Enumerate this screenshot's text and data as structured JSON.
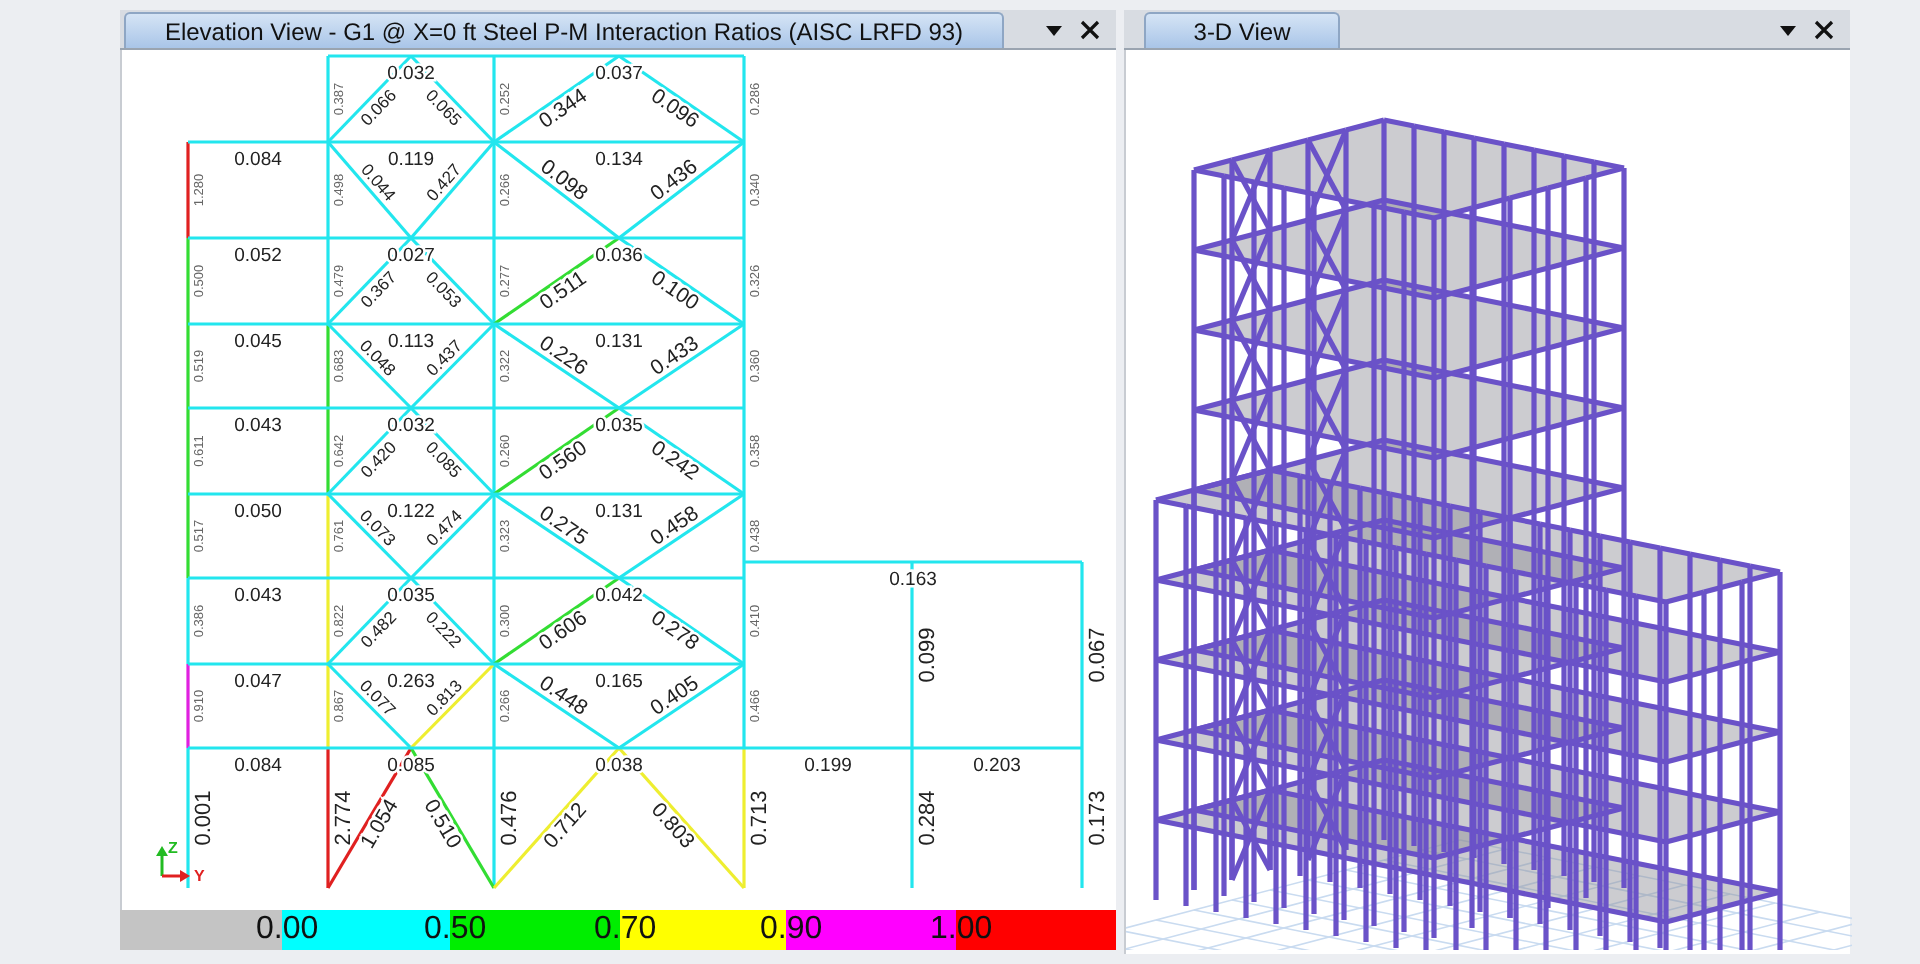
{
  "elevation_view": {
    "title": "Elevation View - G1 @ X=0 ft  Steel P-M Interaction Ratios  (AISC LRFD 93)",
    "columns": [
      {
        "segments": [
          {
            "label": "1.280",
            "color": "#e02020"
          },
          {
            "label": "0.500",
            "color": "#33dd33"
          },
          {
            "label": "0.519",
            "color": "#33dd33"
          },
          {
            "label": "0.611",
            "color": "#33dd33"
          },
          {
            "label": "0.517",
            "color": "#33dd33"
          },
          {
            "label": "0.386",
            "color": "#22e6ee"
          },
          {
            "label": "0.910",
            "color": "#e020e0"
          },
          {
            "label": "0.001",
            "color": "#22e6ee"
          }
        ]
      },
      {
        "segments": [
          {
            "label": "0.387",
            "color": "#22e6ee"
          },
          {
            "label": "0.498",
            "color": "#22e6ee"
          },
          {
            "label": "0.479",
            "color": "#22e6ee"
          },
          {
            "label": "0.683",
            "color": "#33dd33"
          },
          {
            "label": "0.642",
            "color": "#33dd33"
          },
          {
            "label": "0.761",
            "color": "#eeee30"
          },
          {
            "label": "0.822",
            "color": "#eeee30"
          },
          {
            "label": "0.867",
            "color": "#eeee30"
          },
          {
            "label": "2.774",
            "color": "#e02020"
          }
        ]
      },
      {
        "segments": [
          {
            "label": "0.252",
            "color": "#22e6ee"
          },
          {
            "label": "0.266",
            "color": "#22e6ee"
          },
          {
            "label": "0.277",
            "color": "#22e6ee"
          },
          {
            "label": "0.322",
            "color": "#22e6ee"
          },
          {
            "label": "0.260",
            "color": "#22e6ee"
          },
          {
            "label": "0.323",
            "color": "#22e6ee"
          },
          {
            "label": "0.300",
            "color": "#22e6ee"
          },
          {
            "label": "0.266",
            "color": "#22e6ee"
          },
          {
            "label": "0.476",
            "color": "#22e6ee"
          }
        ]
      },
      {
        "segments": [
          {
            "label": "0.286",
            "color": "#22e6ee"
          },
          {
            "label": "0.340",
            "color": "#22e6ee"
          },
          {
            "label": "0.326",
            "color": "#22e6ee"
          },
          {
            "label": "0.360",
            "color": "#22e6ee"
          },
          {
            "label": "0.358",
            "color": "#22e6ee"
          },
          {
            "label": "0.438",
            "color": "#22e6ee"
          },
          {
            "label": "0.410",
            "color": "#22e6ee"
          },
          {
            "label": "0.466",
            "color": "#22e6ee"
          },
          {
            "label": "0.713",
            "color": "#eeee30"
          }
        ]
      }
    ],
    "beams": [
      {
        "segments": [
          {
            "label": "0.084",
            "color": "#22e6ee"
          },
          {
            "label": "0.052",
            "color": "#22e6ee"
          },
          {
            "label": "0.045",
            "color": "#22e6ee"
          },
          {
            "label": "0.043",
            "color": "#22e6ee"
          },
          {
            "label": "0.050",
            "color": "#22e6ee"
          },
          {
            "label": "0.043",
            "color": "#22e6ee"
          },
          {
            "label": "0.047",
            "color": "#22e6ee"
          },
          {
            "label": "0.084",
            "color": "#22e6ee"
          }
        ]
      },
      {
        "segments": [
          {
            "label": "0.032",
            "color": "#22e6ee"
          },
          {
            "label": "0.119",
            "color": "#22e6ee"
          },
          {
            "label": "0.027",
            "color": "#22e6ee"
          },
          {
            "label": "0.113",
            "color": "#22e6ee"
          },
          {
            "label": "0.032",
            "color": "#22e6ee"
          },
          {
            "label": "0.122",
            "color": "#22e6ee"
          },
          {
            "label": "0.035",
            "color": "#22e6ee"
          },
          {
            "label": "0.263",
            "color": "#22e6ee"
          },
          {
            "label": "0.085",
            "color": "#22e6ee"
          }
        ]
      },
      {
        "segments": [
          {
            "label": "0.037",
            "color": "#22e6ee"
          },
          {
            "label": "0.134",
            "color": "#22e6ee"
          },
          {
            "label": "0.036",
            "color": "#22e6ee"
          },
          {
            "label": "0.131",
            "color": "#22e6ee"
          },
          {
            "label": "0.035",
            "color": "#22e6ee"
          },
          {
            "label": "0.131",
            "color": "#22e6ee"
          },
          {
            "label": "0.042",
            "color": "#22e6ee"
          },
          {
            "label": "0.165",
            "color": "#22e6ee"
          },
          {
            "label": "0.038",
            "color": "#22e6ee"
          }
        ]
      }
    ],
    "braces": [
      {
        "stories": [
          {
            "left": {
              "label": "0.066",
              "color": "#22e6ee"
            },
            "right": {
              "label": "0.065",
              "color": "#22e6ee"
            }
          },
          {
            "left": {
              "label": "0.044",
              "color": "#22e6ee"
            },
            "right": {
              "label": "0.427",
              "color": "#22e6ee"
            }
          },
          {
            "left": {
              "label": "0.367",
              "color": "#22e6ee"
            },
            "right": {
              "label": "0.053",
              "color": "#22e6ee"
            }
          },
          {
            "left": {
              "label": "0.048",
              "color": "#22e6ee"
            },
            "right": {
              "label": "0.437",
              "color": "#22e6ee"
            }
          },
          {
            "left": {
              "label": "0.420",
              "color": "#22e6ee"
            },
            "right": {
              "label": "0.085",
              "color": "#22e6ee"
            }
          },
          {
            "left": {
              "label": "0.073",
              "color": "#22e6ee"
            },
            "right": {
              "label": "0.474",
              "color": "#22e6ee"
            }
          },
          {
            "left": {
              "label": "0.482",
              "color": "#22e6ee"
            },
            "right": {
              "label": "0.222",
              "color": "#22e6ee"
            }
          },
          {
            "left": {
              "label": "0.077",
              "color": "#22e6ee"
            },
            "right": {
              "label": "0.813",
              "color": "#eeee30"
            }
          },
          {
            "left": {
              "label": "1.054",
              "color": "#e02020"
            },
            "right": {
              "label": "0.510",
              "color": "#33dd33"
            }
          }
        ]
      },
      {
        "stories": [
          {
            "left": {
              "label": "0.344",
              "color": "#22e6ee"
            },
            "right": {
              "label": "0.096",
              "color": "#22e6ee"
            }
          },
          {
            "left": {
              "label": "0.098",
              "color": "#22e6ee"
            },
            "right": {
              "label": "0.436",
              "color": "#22e6ee"
            }
          },
          {
            "left": {
              "label": "0.511",
              "color": "#33dd33"
            },
            "right": {
              "label": "0.100",
              "color": "#22e6ee"
            }
          },
          {
            "left": {
              "label": "0.226",
              "color": "#22e6ee"
            },
            "right": {
              "label": "0.433",
              "color": "#22e6ee"
            }
          },
          {
            "left": {
              "label": "0.560",
              "color": "#33dd33"
            },
            "right": {
              "label": "0.242",
              "color": "#22e6ee"
            }
          },
          {
            "left": {
              "label": "0.275",
              "color": "#22e6ee"
            },
            "right": {
              "label": "0.458",
              "color": "#22e6ee"
            }
          },
          {
            "left": {
              "label": "0.606",
              "color": "#33dd33"
            },
            "right": {
              "label": "0.278",
              "color": "#22e6ee"
            }
          },
          {
            "left": {
              "label": "0.448",
              "color": "#22e6ee"
            },
            "right": {
              "label": "0.405",
              "color": "#22e6ee"
            }
          },
          {
            "left": {
              "label": "0.712",
              "color": "#eeee30"
            },
            "right": {
              "label": "0.803",
              "color": "#eeee30"
            }
          }
        ]
      }
    ],
    "annex_columns": [
      {
        "segments": [
          {
            "label": "0.099",
            "color": "#22e6ee"
          },
          {
            "label": "0.284",
            "color": "#22e6ee"
          }
        ]
      },
      {
        "segments": [
          {
            "label": "0.067",
            "color": "#22e6ee"
          },
          {
            "label": "0.173",
            "color": "#22e6ee"
          }
        ]
      }
    ],
    "annex_beams": [
      {
        "label": "0.163",
        "color": "#22e6ee"
      },
      {
        "label": "0.199",
        "color": "#22e6ee"
      },
      {
        "label": "0.203",
        "color": "#22e6ee"
      }
    ],
    "axes": [
      {
        "label": "Z",
        "color": "#22bb22"
      },
      {
        "label": "Y",
        "color": "#e02020"
      }
    ],
    "legend": [
      {
        "color": "#c4c4c4"
      },
      {
        "label": "0.00",
        "color": "#00ffff"
      },
      {
        "label": "0.50",
        "color": "#00ee00"
      },
      {
        "label": "0.70",
        "color": "#ffff00"
      },
      {
        "label": "0.90",
        "color": "#ff00ff"
      },
      {
        "label": "1.00",
        "color": "#ff0000"
      }
    ]
  },
  "view_3d": {
    "title": "3-D View"
  }
}
